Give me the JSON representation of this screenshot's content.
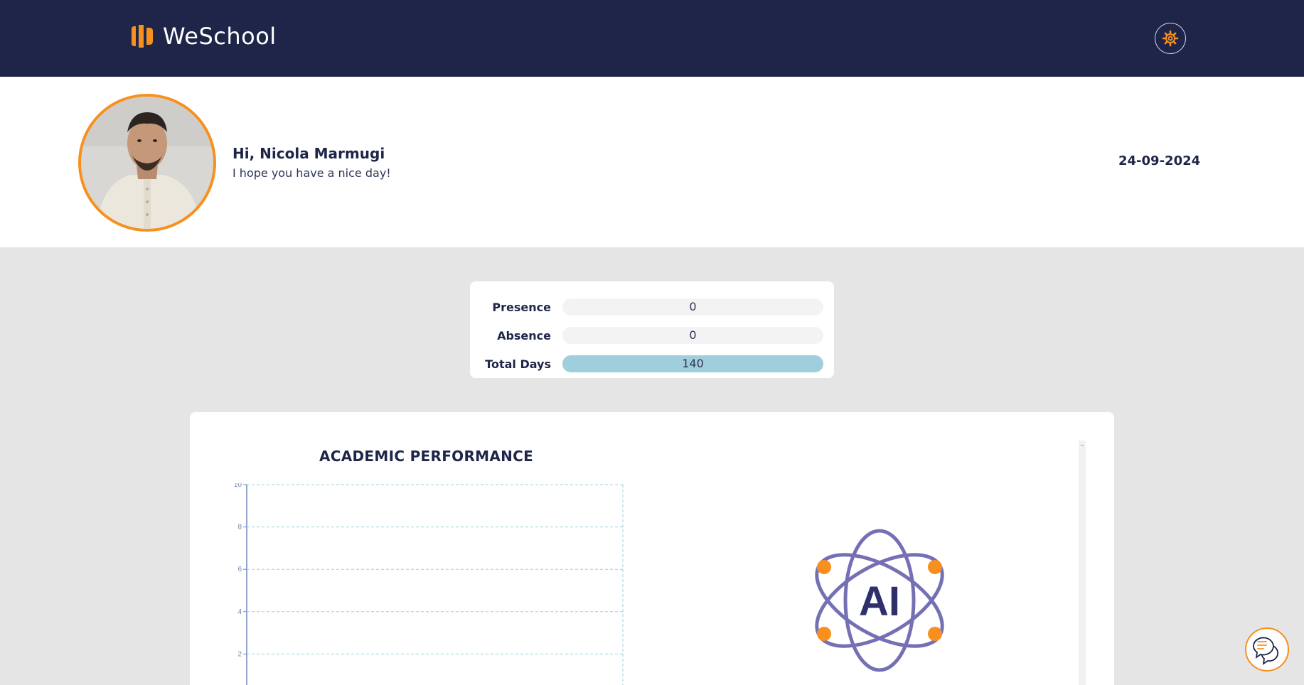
{
  "header": {
    "app_name": "WeSchool",
    "logo_icon": "weschool-logo-icon",
    "settings_icon": "gear-icon"
  },
  "profile": {
    "greeting": "Hi, Nicola Marmugi",
    "subtitle": "I hope you have a nice day!",
    "date": "24-09-2024",
    "avatar": "user-avatar-photo"
  },
  "attendance": {
    "rows": [
      {
        "label": "Presence",
        "value": "0"
      },
      {
        "label": "Absence",
        "value": "0"
      },
      {
        "label": "Total Days",
        "value": "140"
      }
    ]
  },
  "performance": {
    "title": "ACADEMIC PERFORMANCE",
    "ai_icon_text": "AI"
  },
  "chart_data": {
    "type": "line",
    "title": "ACADEMIC PERFORMANCE",
    "y_ticks": [
      "10",
      "8",
      "6",
      "4",
      "2"
    ],
    "ylim": [
      0,
      10
    ],
    "grid": true,
    "series": []
  },
  "colors": {
    "navy": "#1e2549",
    "accent_orange": "#f7901e",
    "bar_fill": "#9fcfdc",
    "ai_purple": "#7570b3",
    "grid_line": "#9fcfdc"
  },
  "chat": {
    "icon": "chat-bubbles-icon"
  }
}
